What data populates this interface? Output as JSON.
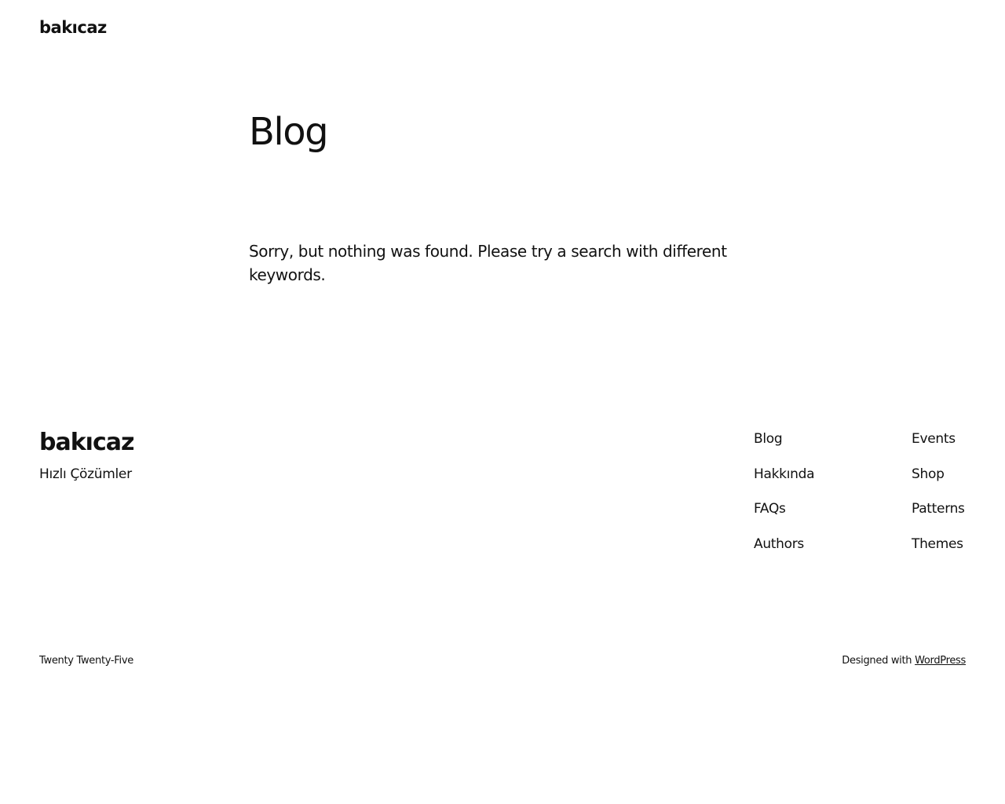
{
  "header": {
    "site_title": "bakıcaz"
  },
  "main": {
    "title": "Blog",
    "no_results_message": "Sorry, but nothing was found. Please try a search with different keywords."
  },
  "footer": {
    "site_title": "bakıcaz",
    "tagline": "Hızlı Çözümler",
    "nav_col_1": [
      "Blog",
      "Hakkında",
      "FAQs",
      "Authors"
    ],
    "nav_col_2": [
      "Events",
      "Shop",
      "Patterns",
      "Themes"
    ],
    "theme_name": "Twenty Twenty-Five",
    "credit_prefix": "Designed with ",
    "credit_link": "WordPress"
  }
}
